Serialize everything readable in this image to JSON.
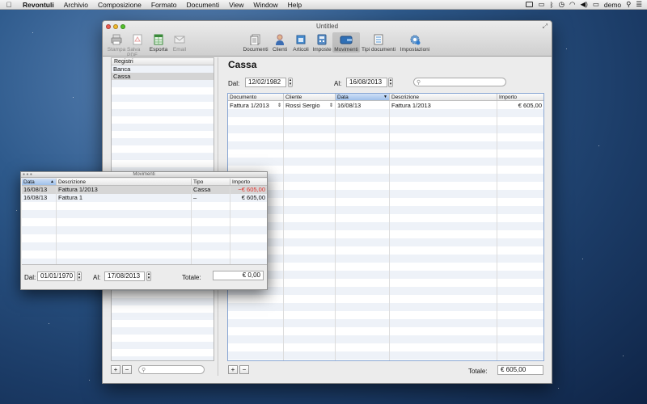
{
  "menubar": {
    "app_name": "Revontuli",
    "items": [
      "Archivio",
      "Composizione",
      "Formato",
      "Documenti",
      "View",
      "Window",
      "Help"
    ],
    "user": "demo"
  },
  "window": {
    "title": "Untitled",
    "toolbar_left": [
      {
        "label": "Stampa",
        "icon": "printer-icon",
        "enabled": false
      },
      {
        "label": "Salva PDF",
        "icon": "pdf-icon",
        "enabled": false
      },
      {
        "label": "Esporta",
        "icon": "spreadsheet-icon",
        "enabled": true
      },
      {
        "label": "Email",
        "icon": "mail-icon",
        "enabled": false
      }
    ],
    "toolbar_right": [
      {
        "label": "Documenti",
        "icon": "documents-icon"
      },
      {
        "label": "Clienti",
        "icon": "person-icon"
      },
      {
        "label": "Articoli",
        "icon": "box-icon"
      },
      {
        "label": "Imposte",
        "icon": "calculator-icon"
      },
      {
        "label": "Movimenti",
        "icon": "wallet-icon",
        "active": true
      },
      {
        "label": "Tipi documenti",
        "icon": "doc-types-icon"
      },
      {
        "label": "Impostazioni",
        "icon": "gear-icon"
      }
    ]
  },
  "sidebar": {
    "header": "Registri",
    "items": [
      {
        "label": "Banca",
        "selected": false
      },
      {
        "label": "Cassa",
        "selected": true
      }
    ],
    "add_label": "+",
    "remove_label": "−"
  },
  "main": {
    "title": "Cassa",
    "dal_label": "Dal:",
    "dal_value": "12/02/1982",
    "al_label": "Al:",
    "al_value": "16/08/2013",
    "search_placeholder": "",
    "columns": [
      "Documento",
      "Cliente",
      "Data",
      "Descrizione",
      "Importo"
    ],
    "rows": [
      {
        "documento": "Fattura 1/2013",
        "cliente": "Rossi Sergio",
        "data": "16/08/13",
        "descrizione": "Fattura 1/2013",
        "importo": "€ 605,00"
      }
    ],
    "add_label": "+",
    "remove_label": "−",
    "totale_label": "Totale:",
    "totale_value": "€ 605,00"
  },
  "movimenti": {
    "title": "Movimenti",
    "columns": [
      "Data",
      "Descrizione",
      "Tipo",
      "Importo"
    ],
    "rows": [
      {
        "data": "16/08/13",
        "descrizione": "Fattura 1/2013",
        "tipo": "Cassa",
        "importo": "−€ 605,00",
        "negative": true
      },
      {
        "data": "16/08/13",
        "descrizione": "Fattura 1",
        "tipo": "–",
        "importo": "€ 605,00",
        "negative": false
      }
    ],
    "dal_label": "Dal:",
    "dal_value": "01/01/1970",
    "al_label": "Al:",
    "al_value": "17/08/2013",
    "totale_label": "Totale:",
    "totale_value": "€ 0,00"
  },
  "colors": {
    "table_border": "#8aa7d4",
    "sorted_header": "#9fc0ea",
    "negative": "#e0302a"
  }
}
